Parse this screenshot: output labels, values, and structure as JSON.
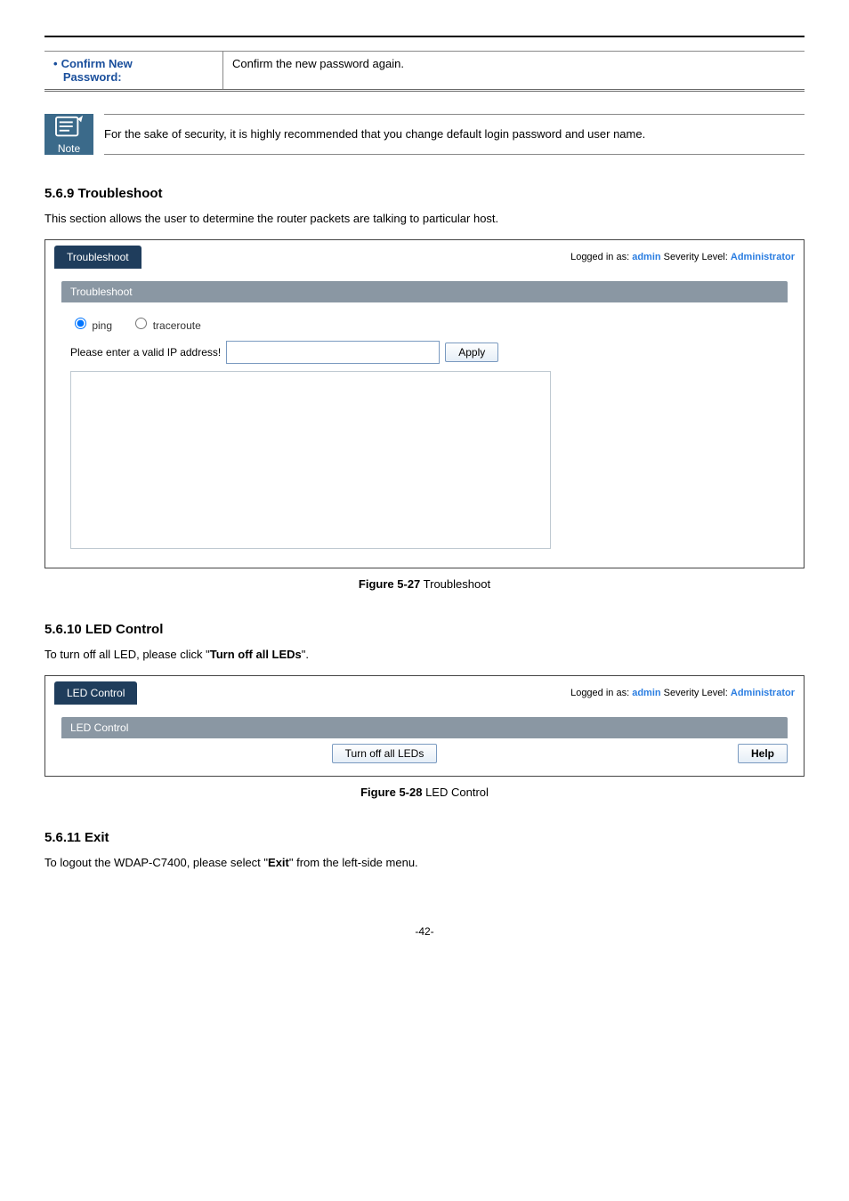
{
  "param_row": {
    "label_line1": "Confirm New",
    "label_line2": "Password:",
    "desc": "Confirm the new password again."
  },
  "note": {
    "label": "Note",
    "text": "For the sake of security, it is highly recommended that you change default login password and user name."
  },
  "sec_569": {
    "heading": "5.6.9  Troubleshoot",
    "intro": "This section allows the user to determine the router packets are talking to particular host."
  },
  "ts_ui": {
    "tab": "Troubleshoot",
    "login_prefix": "Logged in as: ",
    "login_user": "admin",
    "login_sep": "    Severity Level: ",
    "login_level": "Administrator",
    "subhead": "Troubleshoot",
    "radio_ping": "ping",
    "radio_trace": "traceroute",
    "ip_label": "Please enter a valid IP address!",
    "ip_value": "",
    "apply": "Apply",
    "textarea_value": "",
    "caption_bold": "Figure 5-27",
    "caption_rest": " Troubleshoot"
  },
  "sec_5610": {
    "heading": "5.6.10 LED Control",
    "intro_pre": "To turn off all LED, please click \"",
    "intro_bold": "Turn off all LEDs",
    "intro_post": "\"."
  },
  "led_ui": {
    "tab": "LED Control",
    "login_prefix": "Logged in as: ",
    "login_user": "admin",
    "login_sep": "    Severity Level: ",
    "login_level": "Administrator",
    "subhead": "LED Control",
    "turn_off": "Turn off all LEDs",
    "help": "Help",
    "caption_bold": "Figure 5-28",
    "caption_rest": " LED Control"
  },
  "sec_5611": {
    "heading": "5.6.11 Exit",
    "intro_pre": "To logout the WDAP-C7400, please select \"",
    "intro_bold": "Exit",
    "intro_post": "\" from the left-side menu."
  },
  "page_num": "-42-"
}
